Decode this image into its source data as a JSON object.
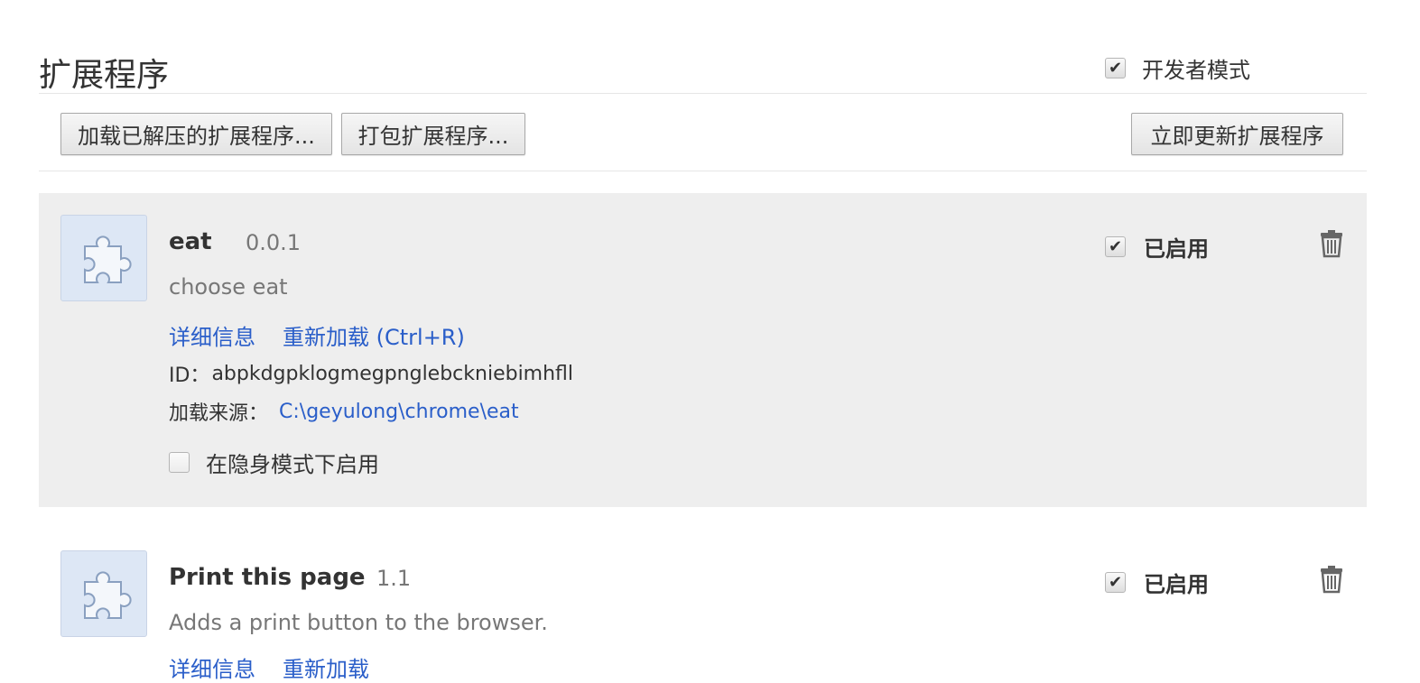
{
  "header": {
    "title": "扩展程序",
    "dev_mode_label": "开发者模式",
    "dev_mode_checked": true
  },
  "toolbar": {
    "load_unpacked_label": "加载已解压的扩展程序...",
    "pack_label": "打包扩展程序...",
    "update_label": "立即更新扩展程序"
  },
  "extensions": [
    {
      "name": "eat",
      "version": "0.0.1",
      "description": "choose eat",
      "details_label": "详细信息",
      "reload_label": "重新加载 (Ctrl+R)",
      "id_label": "ID：",
      "id_value": "abpkdgpklogmegpnglebckniebimhfll",
      "source_label": "加载来源：",
      "source_path": "C:\\geyulong\\chrome\\eat",
      "incognito_label": "在隐身模式下启用",
      "incognito_checked": false,
      "enabled_label": "已启用",
      "enabled_checked": true,
      "icon": "puzzle-icon"
    },
    {
      "name": "Print this page",
      "version": "1.1",
      "description": "Adds a print button to the browser.",
      "details_label": "详细信息",
      "reload_label": "重新加载",
      "enabled_label": "已启用",
      "enabled_checked": true,
      "icon": "puzzle-icon"
    }
  ],
  "icons": {
    "check": "✔",
    "trash": "trash-icon",
    "puzzle": "puzzle-icon"
  },
  "colors": {
    "link": "#2a5ec9",
    "highlight_bg": "#eeeeee",
    "icon_bg": "#dde7f5"
  }
}
